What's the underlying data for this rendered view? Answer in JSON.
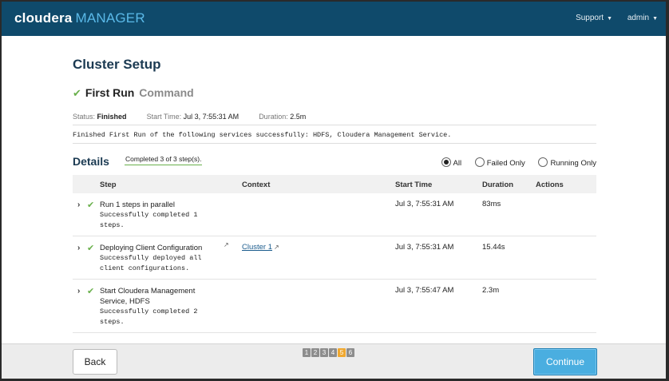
{
  "header": {
    "brand": "cloudera",
    "product": "MANAGER",
    "nav": [
      {
        "label": "Support"
      },
      {
        "label": "admin"
      }
    ]
  },
  "page": {
    "title": "Cluster Setup",
    "command_title_strong": "First Run",
    "command_title_muted": "Command",
    "status_label": "Status:",
    "status_value": "Finished",
    "start_time_label": "Start Time:",
    "start_time_value": "Jul 3, 7:55:31 AM",
    "duration_label": "Duration:",
    "duration_value": "2.5m",
    "message": "Finished First Run of the following services successfully: HDFS, Cloudera Management Service."
  },
  "details": {
    "title": "Details",
    "completed_badge": "Completed 3 of 3 step(s).",
    "filters": [
      {
        "label": "All",
        "selected": true
      },
      {
        "label": "Failed Only",
        "selected": false
      },
      {
        "label": "Running Only",
        "selected": false
      }
    ],
    "columns": [
      "Step",
      "Context",
      "Start Time",
      "Duration",
      "Actions"
    ],
    "rows": [
      {
        "title": "Run 1 steps in parallel",
        "sub": "Successfully completed 1 steps.",
        "context": "",
        "start": "Jul 3, 7:55:31 AM",
        "duration": "83ms"
      },
      {
        "title": "Deploying Client Configuration",
        "sub": "Successfully deployed all client configurations.",
        "context": "Cluster 1",
        "start": "Jul 3, 7:55:31 AM",
        "duration": "15.44s"
      },
      {
        "title": "Start Cloudera Management Service, HDFS",
        "sub": "Successfully completed 2 steps.",
        "context": "",
        "start": "Jul 3, 7:55:47 AM",
        "duration": "2.3m"
      }
    ]
  },
  "footer": {
    "back_label": "Back",
    "continue_label": "Continue",
    "pages": [
      "1",
      "2",
      "3",
      "4",
      "5",
      "6"
    ],
    "current_page": "5"
  },
  "colors": {
    "topbar": "#0f4a6b",
    "accent": "#4aaee0",
    "success": "#6ab04c",
    "pager_active": "#f0a830"
  }
}
